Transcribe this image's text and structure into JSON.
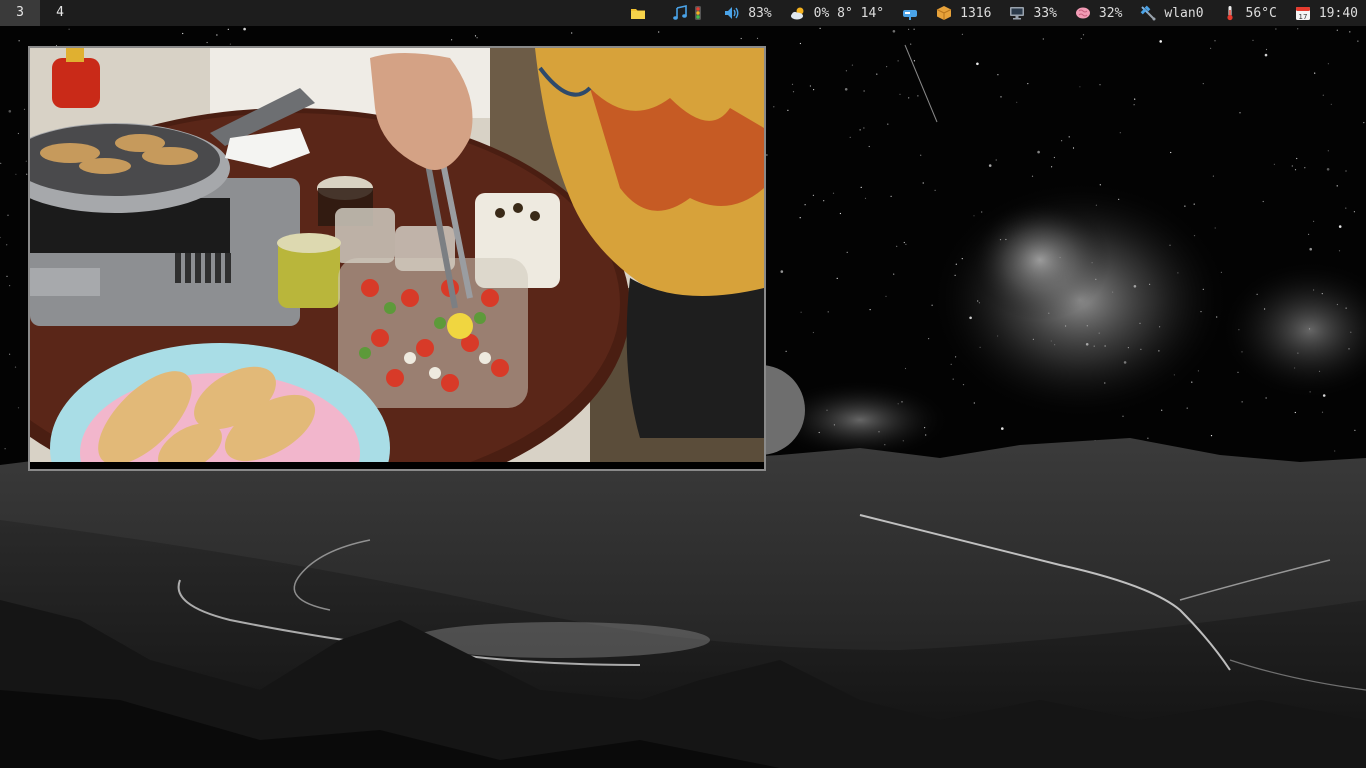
{
  "workspaces": [
    {
      "label": "3",
      "active": true
    },
    {
      "label": "4",
      "active": false
    }
  ],
  "status": {
    "files": {
      "icon": "folder-icon"
    },
    "music": {
      "icon": "music-notes-icon"
    },
    "traffic": {
      "icon": "traffic-light-icon"
    },
    "volume": {
      "icon": "speaker-icon",
      "text": "83%"
    },
    "weather": {
      "icon": "weather-cloud-sun-icon",
      "text": "0% 8° 14°"
    },
    "mail": {
      "icon": "mailbox-icon"
    },
    "packages": {
      "icon": "package-icon",
      "text": "1316"
    },
    "cpu": {
      "icon": "monitor-icon",
      "text": "33%"
    },
    "memory": {
      "icon": "brain-icon",
      "text": "32%"
    },
    "network": {
      "icon": "satellite-icon",
      "text": "wlan0"
    },
    "temperature": {
      "icon": "thermometer-icon",
      "text": "56°C"
    },
    "clock": {
      "icon": "calendar-icon",
      "calendar_day": "17",
      "text": "19:40"
    }
  },
  "colors": {
    "bar_bg": "#1d1d1d",
    "active_workspace": "#3a3a3a",
    "window_border": "#8a8a8a"
  }
}
